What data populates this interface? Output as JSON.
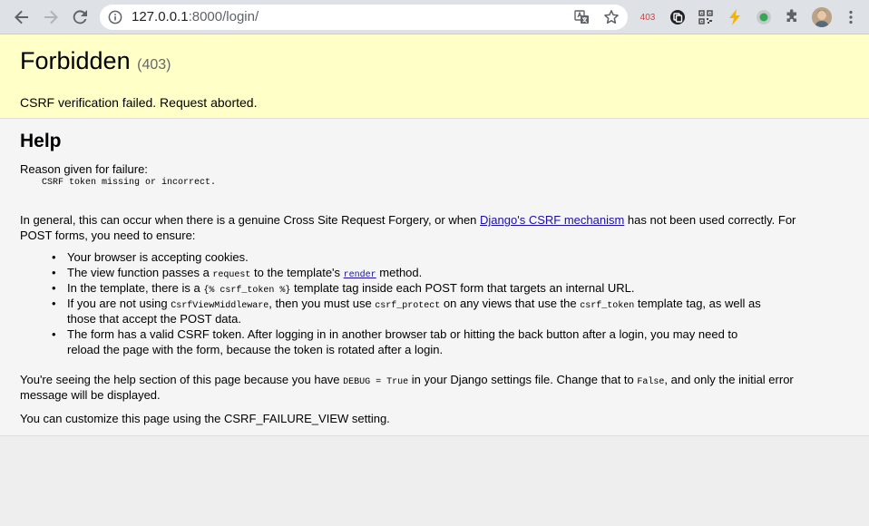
{
  "browser": {
    "url_host": "127.0.0.1",
    "url_rest": ":8000/login/",
    "extensions": {
      "badge_403": "403"
    }
  },
  "summary": {
    "title": "Forbidden",
    "status_code": "(403)",
    "message": "CSRF verification failed. Request aborted."
  },
  "info": {
    "heading": "Help",
    "reason_label": "Reason given for failure:",
    "reason_value": "CSRF token missing or incorrect.",
    "general_pre": "In general, this can occur when there is a genuine Cross Site Request Forgery, or when ",
    "general_link": "Django's CSRF mechanism",
    "general_post": " has not been used correctly. For",
    "general_line2": "POST forms, you need to ensure:",
    "bullets": {
      "b1": "Your browser is accepting cookies.",
      "b2_pre": "The view function passes a ",
      "b2_code": "request",
      "b2_mid": " to the template's ",
      "b2_link": "render",
      "b2_post": " method.",
      "b3_pre": "In the template, there is a ",
      "b3_code": "{% csrf_token %}",
      "b3_post": " template tag inside each POST form that targets an internal URL.",
      "b4_pre": "If you are not using ",
      "b4_code1": "CsrfViewMiddleware",
      "b4_mid1": ", then you must use ",
      "b4_code2": "csrf_protect",
      "b4_mid2": " on any views that use the ",
      "b4_code3": "csrf_token",
      "b4_post": " template tag, as well as",
      "b4_line2": "those that accept the POST data.",
      "b5_line1": "The form has a valid CSRF token. After logging in in another browser tab or hitting the back button after a login, you may need to",
      "b5_line2": "reload the page with the form, because the token is rotated after a login."
    },
    "debug_pre": "You're seeing the help section of this page because you have ",
    "debug_code1": "DEBUG = True",
    "debug_mid": " in your Django settings file. Change that to ",
    "debug_code2": "False",
    "debug_post": ", and only the initial error",
    "debug_line2": "message will be displayed.",
    "customize": "You can customize this page using the CSRF_FAILURE_VIEW setting."
  }
}
